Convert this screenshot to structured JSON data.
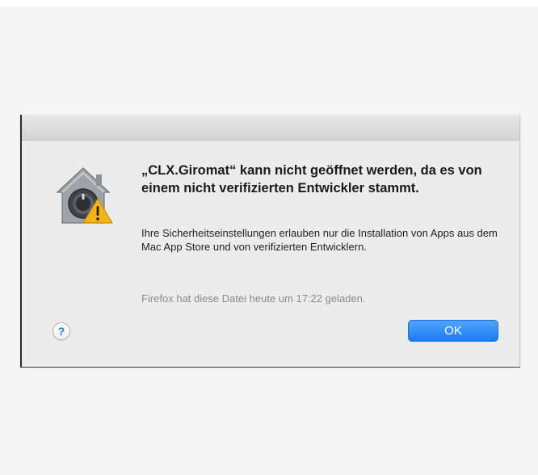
{
  "dialog": {
    "heading": "„CLX.Giromat“ kann nicht geöffnet werden, da es von einem nicht verifizierten Entwickler stammt.",
    "body": "Ihre Sicherheitseinstellungen erlauben nur die Installation von Apps aus dem Mac App Store und von verifizierten Entwicklern.",
    "meta": "Firefox hat diese Datei heute um 17:22 geladen.",
    "icon": "gatekeeper-warning-icon",
    "help_label": "?",
    "ok_label": "OK"
  },
  "colors": {
    "accent": "#1f7cf2",
    "dialog_background": "#ececec",
    "warning": "#f2b31b"
  }
}
